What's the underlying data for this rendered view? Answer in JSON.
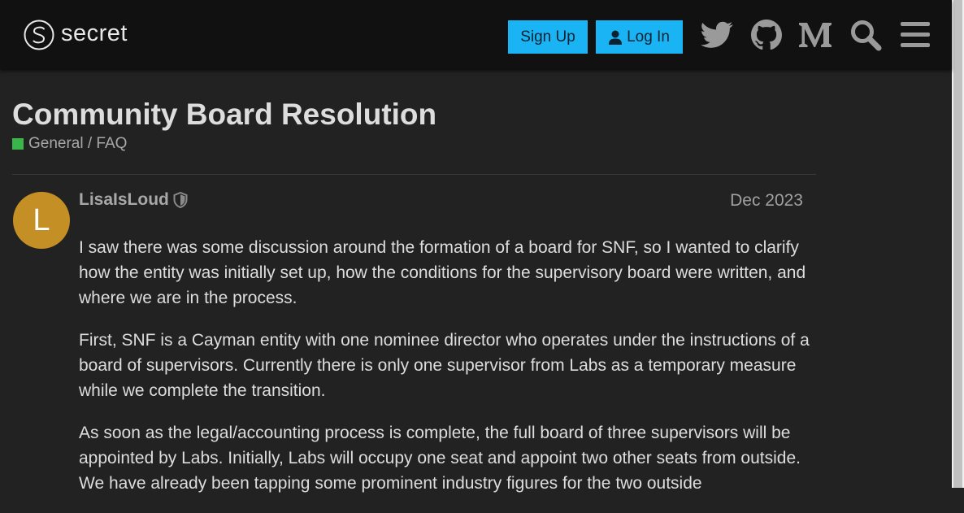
{
  "header": {
    "logo_text": "secret",
    "signup_label": "Sign Up",
    "login_label": "Log In",
    "icons": [
      "twitter-icon",
      "github-icon",
      "medium-icon",
      "search-icon",
      "hamburger-menu-icon"
    ]
  },
  "topic": {
    "title": "Community Board Resolution",
    "category": "General / FAQ",
    "category_color": "#3ab54a"
  },
  "post": {
    "avatar_letter": "L",
    "avatar_color": "#c48f24",
    "username": "LisaIsLoud",
    "date": "Dec 2023",
    "paragraphs": [
      "I saw there was some discussion around the formation of a board for SNF, so I wanted to clarify how the entity was initially set up, how the conditions for the supervisory board were written, and where we are in the process.",
      "First, SNF is a Cayman entity with one nominee director who operates under the instructions of a board of supervisors. Currently there is only one supervisor from Labs as a temporary measure while we complete the transition.",
      "As soon as the legal/accounting process is complete, the full board of three supervisors will be appointed by Labs. Initially, Labs will occupy one seat and appoint two other seats from outside. We have already been tapping some prominent industry figures for the two outside"
    ]
  },
  "colors": {
    "accent": "#1ab4f5",
    "background": "#222222",
    "header_bg": "#111111"
  }
}
